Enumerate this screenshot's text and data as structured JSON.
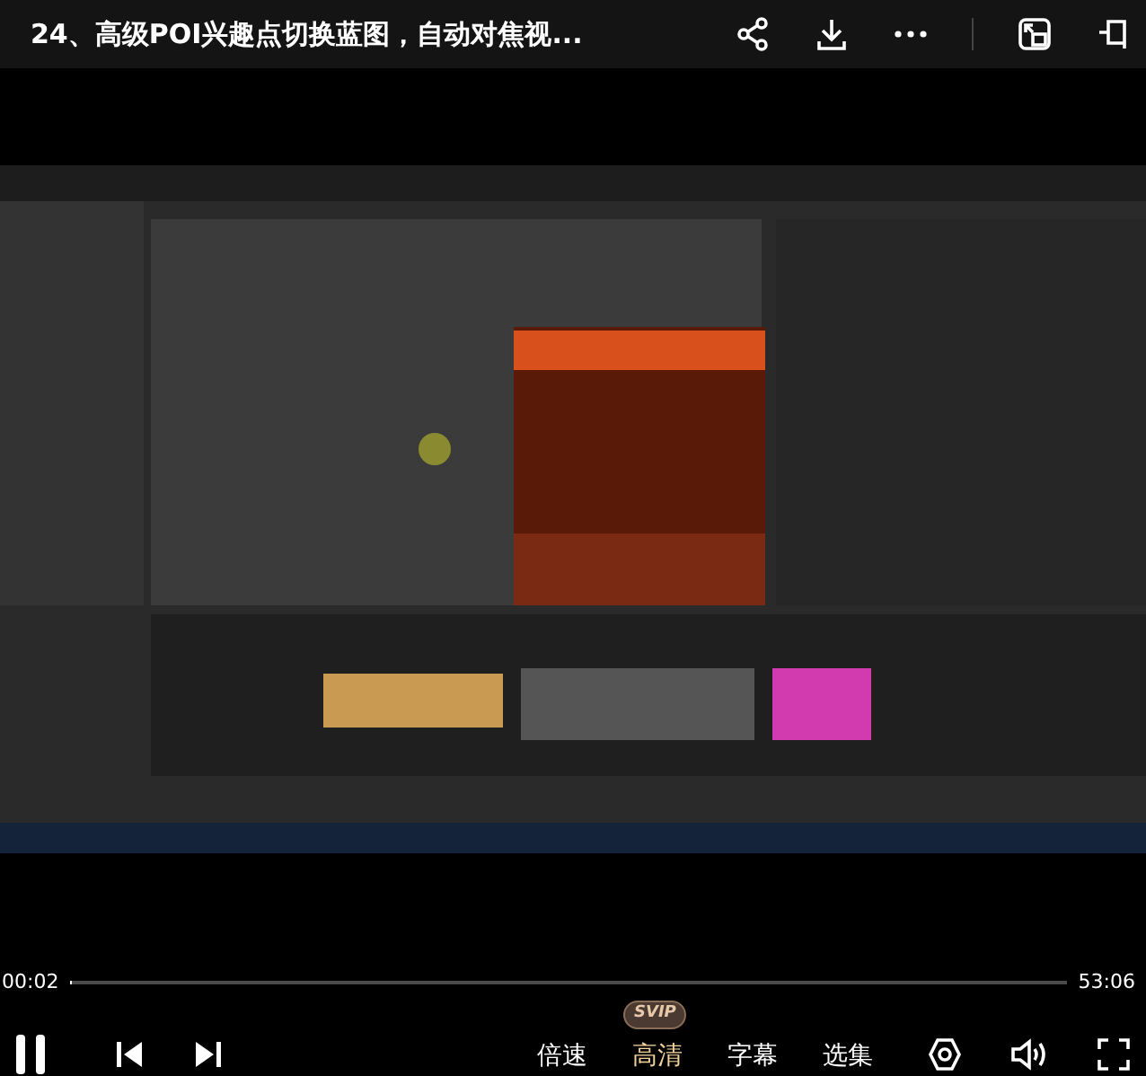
{
  "title": "24、高级POI兴趣点切换蓝图，自动对焦视...",
  "progress": {
    "elapsed": "00:02",
    "duration": "53:06",
    "level": 0.001
  },
  "options": [
    {
      "label": "倍速",
      "selected": false
    },
    {
      "label": "高清",
      "selected": true,
      "badge": "SVIP"
    },
    {
      "label": "字幕",
      "selected": false
    },
    {
      "label": "选集",
      "selected": false
    }
  ]
}
